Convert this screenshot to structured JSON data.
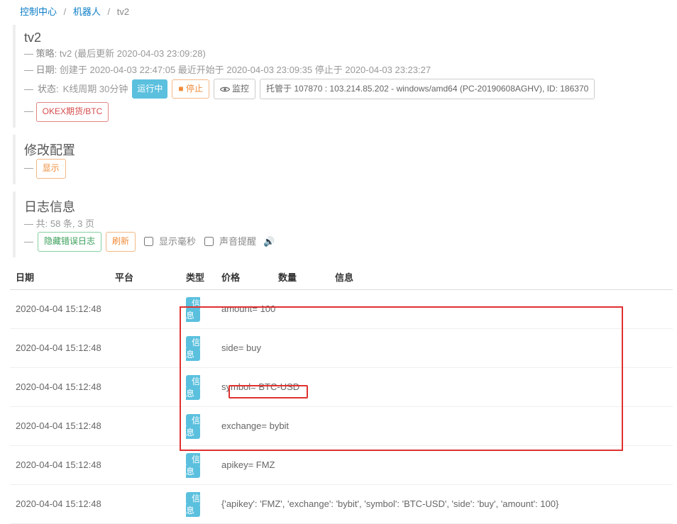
{
  "breadcrumb": {
    "control_center": "控制中心",
    "robots": "机器人",
    "current": "tv2"
  },
  "robot": {
    "name": "tv2",
    "strategy_label": "策略:",
    "strategy_value": "tv2  (最后更新 2020-04-03 23:09:28)",
    "date_label": "日期:",
    "date_value": "创建于 2020-04-03 22:47:05 最近开始于 2020-04-03 23:09:35 停止于 2020-04-03 23:23:27",
    "status_label": "状态:",
    "status_value": "K线周期 30分钟",
    "running_badge": "运行中",
    "stop_btn": "停止",
    "monitor_btn": "监控",
    "hosted_box": "托管于 107870 : 103.214.85.202 - windows/amd64 (PC-20190608AGHV), ID: 186370",
    "exchange_tag": "OKEX期货/BTC"
  },
  "config_panel": {
    "title": "修改配置",
    "show_btn": "显示"
  },
  "log_panel": {
    "title": "日志信息",
    "summary": "共: 58 条, 3 页",
    "hide_err_btn": "隐藏错误日志",
    "refresh_btn": "刷新",
    "show_ms_label": "显示毫秒",
    "sound_label": "声音提醒"
  },
  "table": {
    "headers": {
      "date": "日期",
      "platform": "平台",
      "type": "类型",
      "price": "价格",
      "amount": "数量",
      "msg": "信息"
    },
    "type_pill": "信息",
    "rows": [
      {
        "date": "2020-04-04 15:12:48",
        "msg": "amount= 100"
      },
      {
        "date": "2020-04-04 15:12:48",
        "msg": "side= buy"
      },
      {
        "date": "2020-04-04 15:12:48",
        "msg": "symbol= BTC-USD"
      },
      {
        "date": "2020-04-04 15:12:48",
        "msg": "exchange= bybit"
      },
      {
        "date": "2020-04-04 15:12:48",
        "msg": "apikey= FMZ"
      },
      {
        "date": "2020-04-04 15:12:48",
        "msg": "{'apikey': 'FMZ', 'exchange': 'bybit', 'symbol': 'BTC-USD', 'side': 'buy', 'amount': 100}"
      }
    ]
  }
}
